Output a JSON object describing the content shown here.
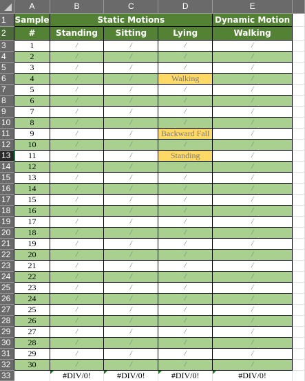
{
  "column_headers": [
    "A",
    "B",
    "C",
    "D",
    "E"
  ],
  "header": {
    "sample_line1": "Sample",
    "sample_line2": "#",
    "static_motions": "Static Motions",
    "dynamic_motion": "Dynamic Motion",
    "standing": "Standing",
    "sitting": "Sitting",
    "lying": "Lying",
    "walking": "Walking"
  },
  "selected_row": 13,
  "rows": [
    {
      "n": 3,
      "sample": "1",
      "b": "/",
      "c": "/",
      "d": "/",
      "e": "/"
    },
    {
      "n": 4,
      "sample": "2",
      "b": "/",
      "c": "/",
      "d": "/",
      "e": "/"
    },
    {
      "n": 5,
      "sample": "3",
      "b": "/",
      "c": "/",
      "d": "/",
      "e": "/"
    },
    {
      "n": 6,
      "sample": "4",
      "b": "/",
      "c": "/",
      "d": "Walking",
      "d_flag": true,
      "e": "/"
    },
    {
      "n": 7,
      "sample": "5",
      "b": "/",
      "c": "/",
      "d": "/",
      "e": "/"
    },
    {
      "n": 8,
      "sample": "6",
      "b": "/",
      "c": "/",
      "d": "/",
      "e": "/"
    },
    {
      "n": 9,
      "sample": "7",
      "b": "/",
      "c": "/",
      "d": "/",
      "e": "/"
    },
    {
      "n": 10,
      "sample": "8",
      "b": "/",
      "c": "/",
      "d": "/",
      "e": "/"
    },
    {
      "n": 11,
      "sample": "9",
      "b": "/",
      "c": "/",
      "d": "Backward Fall",
      "d_flag": true,
      "e": "/"
    },
    {
      "n": 12,
      "sample": "10",
      "b": "/",
      "c": "/",
      "d": "/",
      "e": "/"
    },
    {
      "n": 13,
      "sample": "11",
      "b": "/",
      "c": "/",
      "d": "Standing",
      "d_flag": true,
      "e": "/"
    },
    {
      "n": 14,
      "sample": "12",
      "b": "/",
      "c": "/",
      "d": "/",
      "e": "/"
    },
    {
      "n": 15,
      "sample": "13",
      "b": "/",
      "c": "/",
      "d": "/",
      "e": "/"
    },
    {
      "n": 16,
      "sample": "14",
      "b": "/",
      "c": "/",
      "d": "/",
      "e": "/"
    },
    {
      "n": 17,
      "sample": "15",
      "b": "/",
      "c": "/",
      "d": "/",
      "e": "/"
    },
    {
      "n": 18,
      "sample": "16",
      "b": "/",
      "c": "/",
      "d": "/",
      "e": "/"
    },
    {
      "n": 19,
      "sample": "17",
      "b": "/",
      "c": "/",
      "d": "/",
      "e": "/"
    },
    {
      "n": 20,
      "sample": "18",
      "b": "/",
      "c": "/",
      "d": "/",
      "e": "/"
    },
    {
      "n": 21,
      "sample": "19",
      "b": "/",
      "c": "/",
      "d": "/",
      "e": "/"
    },
    {
      "n": 22,
      "sample": "20",
      "b": "/",
      "c": "/",
      "d": "/",
      "e": "/"
    },
    {
      "n": 23,
      "sample": "21",
      "b": "/",
      "c": "/",
      "d": "/",
      "e": "/"
    },
    {
      "n": 24,
      "sample": "22",
      "b": "/",
      "c": "/",
      "d": "/",
      "e": "/"
    },
    {
      "n": 25,
      "sample": "23",
      "b": "/",
      "c": "/",
      "d": "/",
      "e": "/"
    },
    {
      "n": 26,
      "sample": "24",
      "b": "/",
      "c": "/",
      "d": "/",
      "e": "/"
    },
    {
      "n": 27,
      "sample": "25",
      "b": "/",
      "c": "/",
      "d": "/",
      "e": "/"
    },
    {
      "n": 28,
      "sample": "26",
      "b": "/",
      "c": "/",
      "d": "/",
      "e": "/"
    },
    {
      "n": 29,
      "sample": "27",
      "b": "/",
      "c": "/",
      "d": "/",
      "e": "/"
    },
    {
      "n": 30,
      "sample": "28",
      "b": "/",
      "c": "/",
      "d": "/",
      "e": "/"
    },
    {
      "n": 31,
      "sample": "29",
      "b": "/",
      "c": "/",
      "d": "/",
      "e": "/"
    },
    {
      "n": 32,
      "sample": "30",
      "b": "/",
      "c": "/",
      "d": "/",
      "e": "/"
    }
  ],
  "footer": {
    "n": 33,
    "b": "#DIV/0!",
    "c": "#DIV/0!",
    "d": "#DIV/0!",
    "e": "#DIV/0!"
  },
  "colors": {
    "header_green": "#548235",
    "band_green": "#a9d08e",
    "flag_yellow": "#ffd966"
  }
}
